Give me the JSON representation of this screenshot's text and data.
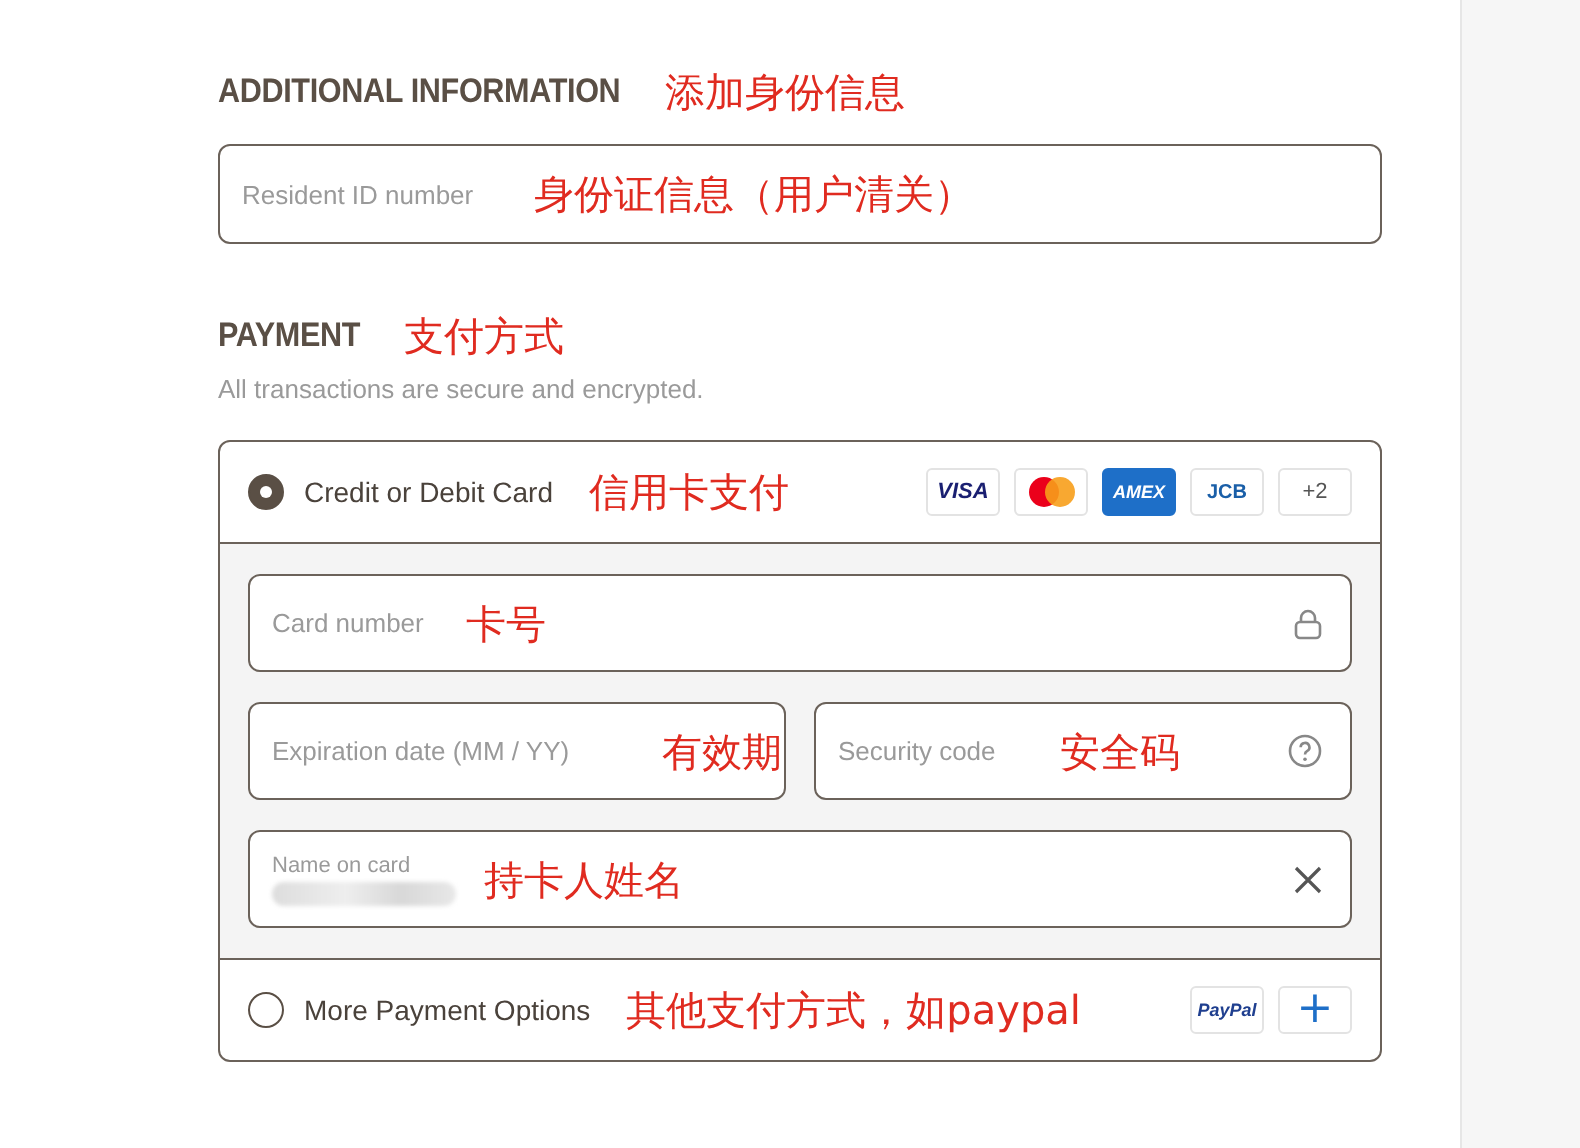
{
  "additional_information": {
    "heading": "ADDITIONAL INFORMATION",
    "annotation": "添加身份信息",
    "field": {
      "placeholder": "Resident ID number",
      "annotation": "身份证信息（用户清关）"
    }
  },
  "payment": {
    "heading": "PAYMENT",
    "annotation": "支付方式",
    "subtitle": "All transactions are secure and encrypted.",
    "options": [
      {
        "label": "Credit or Debit Card",
        "selected": true,
        "annotation": "信用卡支付",
        "badges": [
          {
            "kind": "visa",
            "text": "VISA"
          },
          {
            "kind": "mastercard"
          },
          {
            "kind": "amex",
            "text": "AMEX"
          },
          {
            "kind": "jcb",
            "text": "JCB"
          },
          {
            "kind": "count",
            "text": "+2"
          }
        ],
        "rows": [
          {
            "fields": [
              {
                "kind": "secure",
                "placeholder": "Card number",
                "annotation": "卡号"
              }
            ]
          },
          {
            "fields": [
              {
                "kind": "plain",
                "placeholder": "Expiration date (MM / YY)",
                "annotation": "有效期"
              },
              {
                "kind": "hint",
                "placeholder": "Security code",
                "annotation": "安全码"
              }
            ]
          },
          {
            "fields": [
              {
                "kind": "filled",
                "label": "Name on card",
                "annotation": "持卡人姓名",
                "redacted": true
              }
            ]
          }
        ]
      },
      {
        "label": "More Payment Options",
        "selected": false,
        "annotation": "其他支付方式，如paypal",
        "badges": [
          {
            "kind": "paypal",
            "text": "PayPal"
          },
          {
            "kind": "add",
            "text": "+"
          }
        ]
      }
    ]
  }
}
